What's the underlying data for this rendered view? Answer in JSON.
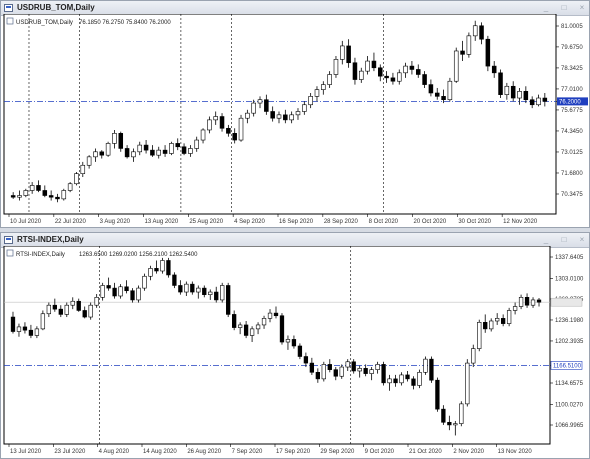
{
  "windows": [
    {
      "title": "USDRUB_TOM,Daily",
      "controls": [
        "_",
        "□",
        "×"
      ]
    },
    {
      "title": "RTSI-INDEX,Daily",
      "controls": [
        "_",
        "□",
        "×"
      ]
    }
  ],
  "chart_data": [
    {
      "type": "candlestick",
      "symbol_label": "USDRUB_TOM,Daily",
      "ohlc_label": "76.1850 76.2750 75.8400 76.2000",
      "y_ticks": [
        "81.0005",
        "79.6750",
        "78.3425",
        "77.0100",
        "76.2000",
        "75.6775",
        "74.3450",
        "73.0125",
        "71.6800",
        "70.3475"
      ],
      "ylim": [
        69.5,
        81.4
      ],
      "x_ticks": [
        "10 Jul 2020",
        "22 Jul 2020",
        "3 Aug 2020",
        "13 Aug 2020",
        "25 Aug 2020",
        "4 Sep 2020",
        "16 Sep 2020",
        "28 Sep 2020",
        "8 Oct 2020",
        "20 Oct 2020",
        "30 Oct 2020",
        "12 Nov 2020"
      ],
      "separators": [
        3,
        11,
        27,
        35,
        59
      ],
      "current_price": 76.2,
      "current_price_label": "76.2000",
      "candles": [
        [
          70.6,
          70.8,
          70.4,
          70.5
        ],
        [
          70.5,
          70.9,
          70.3,
          70.6
        ],
        [
          70.6,
          71.0,
          70.5,
          70.9
        ],
        [
          70.9,
          71.4,
          70.7,
          71.2
        ],
        [
          71.2,
          71.5,
          70.8,
          70.9
        ],
        [
          70.9,
          71.2,
          70.5,
          70.6
        ],
        [
          70.6,
          70.9,
          70.3,
          70.5
        ],
        [
          70.5,
          70.7,
          70.2,
          70.4
        ],
        [
          70.4,
          71.0,
          70.3,
          70.9
        ],
        [
          70.9,
          71.4,
          70.8,
          71.3
        ],
        [
          71.3,
          72.0,
          71.2,
          71.9
        ],
        [
          71.9,
          72.6,
          71.7,
          72.4
        ],
        [
          72.4,
          73.0,
          72.2,
          72.9
        ],
        [
          72.9,
          73.4,
          72.6,
          73.2
        ],
        [
          73.2,
          73.3,
          72.8,
          73.0
        ],
        [
          73.0,
          73.8,
          72.9,
          73.7
        ],
        [
          73.7,
          74.5,
          73.4,
          74.3
        ],
        [
          74.3,
          74.4,
          73.2,
          73.4
        ],
        [
          73.4,
          73.6,
          72.8,
          72.9
        ],
        [
          72.9,
          73.4,
          72.6,
          73.2
        ],
        [
          73.2,
          73.8,
          73.0,
          73.6
        ],
        [
          73.6,
          73.9,
          73.1,
          73.3
        ],
        [
          73.3,
          73.6,
          72.9,
          73.0
        ],
        [
          73.0,
          73.5,
          72.8,
          73.3
        ],
        [
          73.3,
          73.6,
          72.9,
          73.1
        ],
        [
          73.1,
          73.8,
          73.0,
          73.7
        ],
        [
          73.7,
          74.0,
          73.3,
          73.5
        ],
        [
          73.5,
          73.7,
          73.0,
          73.1
        ],
        [
          73.1,
          73.6,
          72.9,
          73.4
        ],
        [
          73.4,
          74.1,
          73.2,
          73.9
        ],
        [
          73.9,
          74.6,
          73.7,
          74.5
        ],
        [
          74.5,
          75.3,
          74.3,
          75.1
        ],
        [
          75.1,
          75.6,
          74.8,
          75.3
        ],
        [
          75.3,
          75.5,
          74.4,
          74.6
        ],
        [
          74.6,
          74.8,
          74.1,
          74.3
        ],
        [
          74.3,
          74.6,
          73.7,
          73.9
        ],
        [
          73.9,
          75.4,
          73.8,
          75.2
        ],
        [
          75.2,
          75.7,
          74.9,
          75.5
        ],
        [
          75.5,
          76.3,
          75.3,
          76.1
        ],
        [
          76.1,
          76.5,
          75.8,
          76.3
        ],
        [
          76.3,
          76.6,
          75.4,
          75.6
        ],
        [
          75.6,
          75.9,
          75.0,
          75.2
        ],
        [
          75.2,
          75.6,
          74.9,
          75.4
        ],
        [
          75.4,
          75.7,
          74.9,
          75.1
        ],
        [
          75.1,
          75.6,
          74.9,
          75.4
        ],
        [
          75.4,
          75.8,
          75.1,
          75.6
        ],
        [
          75.6,
          76.2,
          75.4,
          76.0
        ],
        [
          76.0,
          76.7,
          75.8,
          76.5
        ],
        [
          76.5,
          77.1,
          76.2,
          76.9
        ],
        [
          76.9,
          77.4,
          76.6,
          77.2
        ],
        [
          77.2,
          78.0,
          77.0,
          77.8
        ],
        [
          77.8,
          78.9,
          77.6,
          78.7
        ],
        [
          78.7,
          79.8,
          78.4,
          79.5
        ],
        [
          79.5,
          79.9,
          78.2,
          78.5
        ],
        [
          78.5,
          78.8,
          77.2,
          77.5
        ],
        [
          77.5,
          78.2,
          77.3,
          78.0
        ],
        [
          78.0,
          78.9,
          77.8,
          78.6
        ],
        [
          78.6,
          79.1,
          78.0,
          78.2
        ],
        [
          78.2,
          78.4,
          77.4,
          77.7
        ],
        [
          77.7,
          78.0,
          77.3,
          77.6
        ],
        [
          77.6,
          77.9,
          77.2,
          77.4
        ],
        [
          77.4,
          78.1,
          77.2,
          77.9
        ],
        [
          77.9,
          78.5,
          77.6,
          78.3
        ],
        [
          78.3,
          78.6,
          77.8,
          78.1
        ],
        [
          78.1,
          78.4,
          77.6,
          77.8
        ],
        [
          77.8,
          78.0,
          77.0,
          77.2
        ],
        [
          77.2,
          77.5,
          76.5,
          76.7
        ],
        [
          76.7,
          77.0,
          76.3,
          76.5
        ],
        [
          76.5,
          76.9,
          76.1,
          76.3
        ],
        [
          76.3,
          77.6,
          76.2,
          77.4
        ],
        [
          77.4,
          79.4,
          77.3,
          79.2
        ],
        [
          79.2,
          79.8,
          78.6,
          79.0
        ],
        [
          79.0,
          80.3,
          78.8,
          80.1
        ],
        [
          80.1,
          81.0,
          79.8,
          80.7
        ],
        [
          80.7,
          80.9,
          79.6,
          79.9
        ],
        [
          79.9,
          80.1,
          78.0,
          78.3
        ],
        [
          78.3,
          78.6,
          77.6,
          77.9
        ],
        [
          77.9,
          78.1,
          76.4,
          76.6
        ],
        [
          76.6,
          77.3,
          76.3,
          77.1
        ],
        [
          77.1,
          77.4,
          76.2,
          76.4
        ],
        [
          76.4,
          77.0,
          76.0,
          76.8
        ],
        [
          76.8,
          77.1,
          76.1,
          76.3
        ],
        [
          76.3,
          76.5,
          75.8,
          76.0
        ],
        [
          76.0,
          76.6,
          75.9,
          76.4
        ],
        [
          76.4,
          76.7,
          75.9,
          76.2
        ]
      ]
    },
    {
      "type": "candlestick",
      "symbol_label": "RTSI-INDEX,Daily",
      "ohlc_label": "1263.6500 1269.0200 1256.2100 1262.5400",
      "y_ticks": [
        "1337.6405",
        "1303.0100",
        "1269.9785",
        "1236.1980",
        "1202.3935",
        "1166.5100",
        "1134.6575",
        "1100.0270",
        "1066.9965"
      ],
      "ylim": [
        1047,
        1348
      ],
      "x_ticks": [
        "13 Jul 2020",
        "23 Jul 2020",
        "4 Aug 2020",
        "14 Aug 2020",
        "26 Aug 2020",
        "7 Sep 2020",
        "17 Sep 2020",
        "29 Sep 2020",
        "9 Oct 2020",
        "21 Oct 2020",
        "2 Nov 2020",
        "13 Nov 2020"
      ],
      "separators": [
        15,
        57
      ],
      "current_price": 1262.54,
      "current_price_label": "1262.5400",
      "hline_value": 1166.51,
      "hline_label": "1166.5100",
      "candles": [
        [
          1240,
          1248,
          1215,
          1218
        ],
        [
          1218,
          1230,
          1210,
          1225
        ],
        [
          1225,
          1232,
          1215,
          1220
        ],
        [
          1220,
          1228,
          1208,
          1212
        ],
        [
          1212,
          1226,
          1208,
          1222
        ],
        [
          1222,
          1250,
          1220,
          1245
        ],
        [
          1245,
          1262,
          1240,
          1258
        ],
        [
          1258,
          1268,
          1248,
          1252
        ],
        [
          1252,
          1258,
          1240,
          1244
        ],
        [
          1244,
          1262,
          1240,
          1258
        ],
        [
          1258,
          1270,
          1252,
          1264
        ],
        [
          1264,
          1268,
          1248,
          1250
        ],
        [
          1250,
          1256,
          1238,
          1240
        ],
        [
          1240,
          1262,
          1236,
          1258
        ],
        [
          1258,
          1275,
          1254,
          1270
        ],
        [
          1270,
          1292,
          1265,
          1288
        ],
        [
          1288,
          1300,
          1280,
          1284
        ],
        [
          1284,
          1292,
          1268,
          1272
        ],
        [
          1272,
          1290,
          1268,
          1286
        ],
        [
          1286,
          1296,
          1276,
          1280
        ],
        [
          1280,
          1284,
          1262,
          1266
        ],
        [
          1266,
          1288,
          1262,
          1284
        ],
        [
          1284,
          1306,
          1280,
          1302
        ],
        [
          1302,
          1318,
          1296,
          1314
        ],
        [
          1314,
          1326,
          1306,
          1310
        ],
        [
          1310,
          1330,
          1306,
          1326
        ],
        [
          1326,
          1330,
          1300,
          1304
        ],
        [
          1304,
          1308,
          1284,
          1288
        ],
        [
          1288,
          1296,
          1274,
          1278
        ],
        [
          1278,
          1294,
          1272,
          1290
        ],
        [
          1290,
          1294,
          1274,
          1278
        ],
        [
          1278,
          1288,
          1268,
          1284
        ],
        [
          1284,
          1288,
          1270,
          1274
        ],
        [
          1274,
          1282,
          1266,
          1278
        ],
        [
          1278,
          1286,
          1262,
          1266
        ],
        [
          1266,
          1292,
          1262,
          1288
        ],
        [
          1288,
          1292,
          1240,
          1244
        ],
        [
          1244,
          1250,
          1220,
          1224
        ],
        [
          1224,
          1232,
          1214,
          1228
        ],
        [
          1228,
          1234,
          1208,
          1212
        ],
        [
          1212,
          1226,
          1202,
          1222
        ],
        [
          1222,
          1232,
          1214,
          1228
        ],
        [
          1228,
          1242,
          1222,
          1238
        ],
        [
          1238,
          1252,
          1232,
          1246
        ],
        [
          1246,
          1256,
          1238,
          1242
        ],
        [
          1242,
          1246,
          1198,
          1202
        ],
        [
          1202,
          1212,
          1190,
          1206
        ],
        [
          1206,
          1212,
          1192,
          1196
        ],
        [
          1196,
          1200,
          1176,
          1180
        ],
        [
          1180,
          1186,
          1164,
          1170
        ],
        [
          1170,
          1178,
          1152,
          1156
        ],
        [
          1156,
          1162,
          1140,
          1146
        ],
        [
          1146,
          1172,
          1142,
          1168
        ],
        [
          1168,
          1176,
          1156,
          1160
        ],
        [
          1160,
          1164,
          1144,
          1150
        ],
        [
          1150,
          1168,
          1146,
          1164
        ],
        [
          1164,
          1176,
          1158,
          1172
        ],
        [
          1172,
          1176,
          1154,
          1158
        ],
        [
          1158,
          1166,
          1148,
          1162
        ],
        [
          1162,
          1168,
          1150,
          1154
        ],
        [
          1154,
          1164,
          1144,
          1160
        ],
        [
          1160,
          1172,
          1154,
          1168
        ],
        [
          1168,
          1172,
          1136,
          1140
        ],
        [
          1140,
          1152,
          1128,
          1146
        ],
        [
          1146,
          1152,
          1134,
          1140
        ],
        [
          1140,
          1156,
          1136,
          1152
        ],
        [
          1152,
          1158,
          1142,
          1146
        ],
        [
          1146,
          1150,
          1130,
          1136
        ],
        [
          1136,
          1160,
          1132,
          1156
        ],
        [
          1156,
          1180,
          1152,
          1176
        ],
        [
          1176,
          1180,
          1140,
          1144
        ],
        [
          1144,
          1148,
          1096,
          1100
        ],
        [
          1100,
          1106,
          1076,
          1080
        ],
        [
          1080,
          1090,
          1068,
          1076
        ],
        [
          1076,
          1082,
          1060,
          1078
        ],
        [
          1078,
          1112,
          1074,
          1108
        ],
        [
          1108,
          1176,
          1104,
          1170
        ],
        [
          1170,
          1198,
          1164,
          1192
        ],
        [
          1192,
          1236,
          1188,
          1232
        ],
        [
          1232,
          1244,
          1216,
          1222
        ],
        [
          1222,
          1238,
          1218,
          1234
        ],
        [
          1234,
          1246,
          1228,
          1238
        ],
        [
          1238,
          1244,
          1226,
          1230
        ],
        [
          1230,
          1254,
          1226,
          1250
        ],
        [
          1250,
          1262,
          1244,
          1256
        ],
        [
          1256,
          1274,
          1252,
          1270
        ],
        [
          1270,
          1276,
          1254,
          1258
        ],
        [
          1258,
          1270,
          1254,
          1266
        ],
        [
          1266,
          1269,
          1256,
          1262.54
        ]
      ]
    }
  ],
  "colors": {
    "up_fill": "#ffffff",
    "down_fill": "#000000",
    "stroke": "#000000",
    "grid": "#000000",
    "hline": "#1f3fbf",
    "price_box_bg": "#1f3fbf",
    "price_box_text": "#ffffff",
    "price_line": "#c0c0c0"
  }
}
